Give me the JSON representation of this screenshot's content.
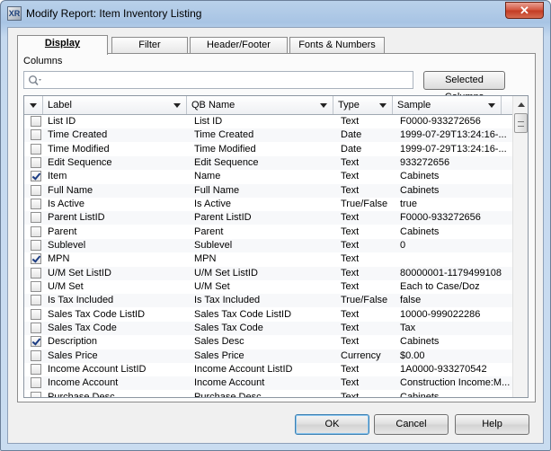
{
  "window": {
    "title": "Modify Report: Item Inventory Listing",
    "app_icon_text": "XR",
    "close_label": "✕"
  },
  "tabs": [
    {
      "label": "Display",
      "active": true
    },
    {
      "label": "Filter",
      "active": false
    },
    {
      "label": "Header/Footer",
      "active": false
    },
    {
      "label": "Fonts & Numbers",
      "active": false
    }
  ],
  "columns_section": {
    "label": "Columns",
    "search_value": "",
    "selected_columns_label": "Selected Columns"
  },
  "grid": {
    "headers": {
      "label": "Label",
      "qbname": "QB Name",
      "type": "Type",
      "sample": "Sample"
    },
    "rows": [
      {
        "checked": false,
        "label": "List ID",
        "qbname": "List ID",
        "type": "Text",
        "sample": "F0000-933272656"
      },
      {
        "checked": false,
        "label": "Time Created",
        "qbname": "Time Created",
        "type": "Date",
        "sample": "1999-07-29T13:24:16-..."
      },
      {
        "checked": false,
        "label": "Time Modified",
        "qbname": "Time Modified",
        "type": "Date",
        "sample": "1999-07-29T13:24:16-..."
      },
      {
        "checked": false,
        "label": "Edit Sequence",
        "qbname": "Edit Sequence",
        "type": "Text",
        "sample": "933272656"
      },
      {
        "checked": true,
        "label": "Item",
        "qbname": "Name",
        "type": "Text",
        "sample": "Cabinets"
      },
      {
        "checked": false,
        "label": "Full Name",
        "qbname": "Full Name",
        "type": "Text",
        "sample": "Cabinets"
      },
      {
        "checked": false,
        "label": "Is Active",
        "qbname": "Is Active",
        "type": "True/False",
        "sample": "true"
      },
      {
        "checked": false,
        "label": "Parent ListID",
        "qbname": "Parent ListID",
        "type": "Text",
        "sample": "F0000-933272656"
      },
      {
        "checked": false,
        "label": "Parent",
        "qbname": "Parent",
        "type": "Text",
        "sample": "Cabinets"
      },
      {
        "checked": false,
        "label": "Sublevel",
        "qbname": "Sublevel",
        "type": "Text",
        "sample": "0"
      },
      {
        "checked": true,
        "label": "MPN",
        "qbname": "MPN",
        "type": "Text",
        "sample": ""
      },
      {
        "checked": false,
        "label": "U/M Set ListID",
        "qbname": "U/M Set ListID",
        "type": "Text",
        "sample": "80000001-1179499108"
      },
      {
        "checked": false,
        "label": "U/M Set",
        "qbname": "U/M Set",
        "type": "Text",
        "sample": "Each to Case/Doz"
      },
      {
        "checked": false,
        "label": "Is Tax Included",
        "qbname": "Is Tax Included",
        "type": "True/False",
        "sample": "false"
      },
      {
        "checked": false,
        "label": "Sales Tax Code ListID",
        "qbname": "Sales Tax Code ListID",
        "type": "Text",
        "sample": "10000-999022286"
      },
      {
        "checked": false,
        "label": "Sales Tax Code",
        "qbname": "Sales Tax Code",
        "type": "Text",
        "sample": "Tax"
      },
      {
        "checked": true,
        "label": "Description",
        "qbname": "Sales Desc",
        "type": "Text",
        "sample": "Cabinets"
      },
      {
        "checked": false,
        "label": "Sales Price",
        "qbname": "Sales Price",
        "type": "Currency",
        "sample": "$0.00"
      },
      {
        "checked": false,
        "label": "Income Account ListID",
        "qbname": "Income Account ListID",
        "type": "Text",
        "sample": "1A0000-933270542"
      },
      {
        "checked": false,
        "label": "Income Account",
        "qbname": "Income Account",
        "type": "Text",
        "sample": "Construction Income:M..."
      },
      {
        "checked": false,
        "label": "Purchase Desc",
        "qbname": "Purchase Desc",
        "type": "Text",
        "sample": "Cabinets"
      }
    ]
  },
  "buttons": {
    "ok": "OK",
    "cancel": "Cancel",
    "help": "Help"
  }
}
